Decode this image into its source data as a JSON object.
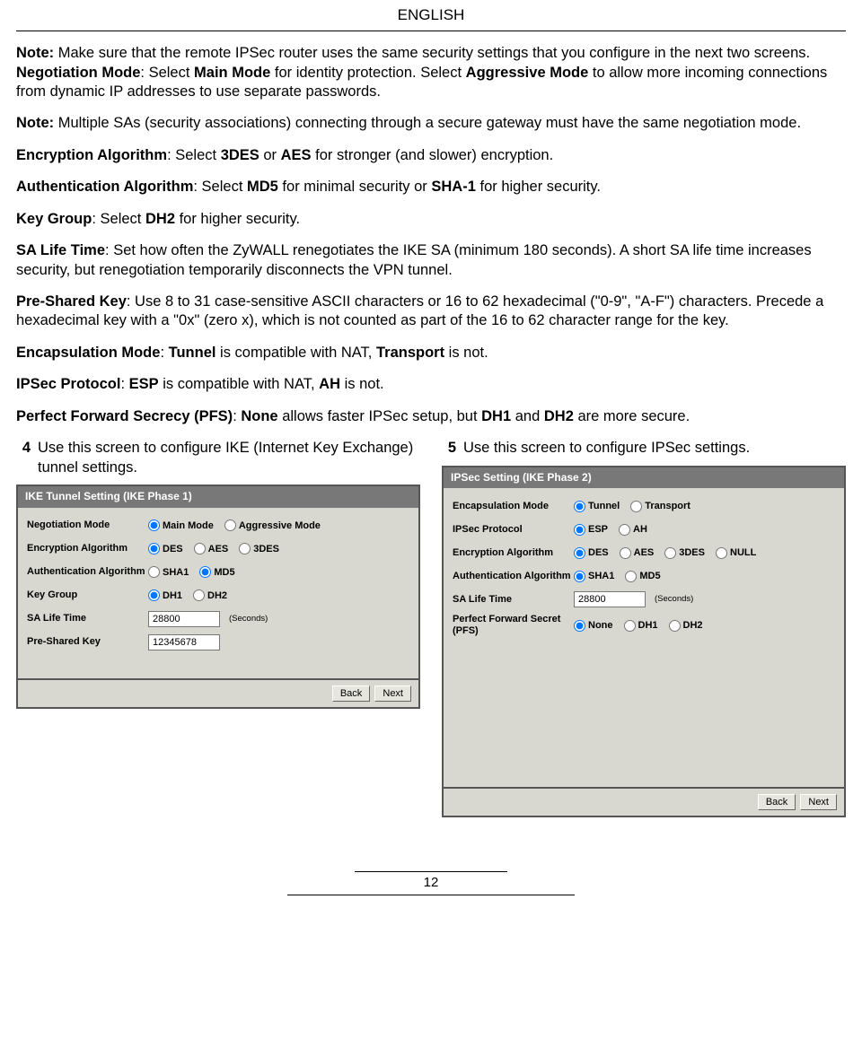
{
  "header": "ENGLISH",
  "paragraphs": {
    "p1a": "Note:",
    "p1b": " Make sure that the remote IPSec router uses the same security settings that you configure in the next two screens.",
    "p2a": "Negotiation Mode",
    "p2b": ": Select ",
    "p2c": "Main Mode",
    "p2d": " for identity protection. Select ",
    "p2e": "Aggressive Mode",
    "p2f": " to allow more incoming connections from dynamic IP addresses to use separate passwords.",
    "p3a": "Note:",
    "p3b": " Multiple SAs (security associations) connecting through a secure gateway must have the same negotiation mode.",
    "p4a": "Encryption Algorithm",
    "p4b": ": Select ",
    "p4c": "3DES",
    "p4d": " or ",
    "p4e": "AES",
    "p4f": " for stronger (and slower) encryption.",
    "p5a": "Authentication Algorithm",
    "p5b": ": Select ",
    "p5c": "MD5",
    "p5d": " for minimal security or ",
    "p5e": "SHA-1",
    "p5f": " for higher security.",
    "p6a": "Key Group",
    "p6b": ": Select ",
    "p6c": "DH2",
    "p6d": " for higher security.",
    "p7a": "SA Life Time",
    "p7b": ": Set how often the ZyWALL renegotiates the IKE SA (minimum 180 seconds). A short SA life time increases security, but renegotiation temporarily disconnects the VPN tunnel.",
    "p8a": "Pre-Shared Key",
    "p8b": ": Use 8 to 31 case-sensitive ASCII characters or 16 to 62 hexadecimal (\"0-9\", \"A-F\") characters. Precede a hexadecimal key with a \"0x\" (zero x), which is not counted as part of the 16 to 62 character range for the key.",
    "p9a": "Encapsulation Mode",
    "p9b": ": ",
    "p9c": "Tunnel",
    "p9d": " is compatible with NAT, ",
    "p9e": "Transport",
    "p9f": " is not.",
    "p10a": "IPSec Protocol",
    "p10b": ": ",
    "p10c": "ESP",
    "p10d": " is compatible with NAT,  ",
    "p10e": "AH",
    "p10f": " is not.",
    "p11a": "Perfect Forward Secrecy (PFS)",
    "p11b": ": ",
    "p11c": "None",
    "p11d": " allows faster IPSec setup, but ",
    "p11e": "DH1",
    "p11f": " and ",
    "p11g": "DH2",
    "p11h": " are more secure."
  },
  "step4": {
    "num": "4",
    "text": "Use this screen to configure IKE (Internet Key Exchange) tunnel settings."
  },
  "step5": {
    "num": "5",
    "text": "Use this screen to configure IPSec settings."
  },
  "panel1": {
    "title": "IKE Tunnel Setting (IKE Phase 1)",
    "negMode": {
      "label": "Negotiation Mode",
      "opts": [
        "Main Mode",
        "Aggressive Mode"
      ],
      "sel": 0
    },
    "encAlg": {
      "label": "Encryption Algorithm",
      "opts": [
        "DES",
        "AES",
        "3DES"
      ],
      "sel": 0
    },
    "authAlg": {
      "label": "Authentication Algorithm",
      "opts": [
        "SHA1",
        "MD5"
      ],
      "sel": 1
    },
    "keyGroup": {
      "label": "Key Group",
      "opts": [
        "DH1",
        "DH2"
      ],
      "sel": 0
    },
    "saLife": {
      "label": "SA Life Time",
      "value": "28800",
      "unit": "(Seconds)"
    },
    "psk": {
      "label": "Pre-Shared Key",
      "value": "12345678"
    },
    "back": "Back",
    "next": "Next"
  },
  "panel2": {
    "title": "IPSec Setting (IKE Phase 2)",
    "encapMode": {
      "label": "Encapsulation Mode",
      "opts": [
        "Tunnel",
        "Transport"
      ],
      "sel": 0
    },
    "ipsecProto": {
      "label": "IPSec Protocol",
      "opts": [
        "ESP",
        "AH"
      ],
      "sel": 0
    },
    "encAlg": {
      "label": "Encryption Algorithm",
      "opts": [
        "DES",
        "AES",
        "3DES",
        "NULL"
      ],
      "sel": 0
    },
    "authAlg": {
      "label": "Authentication Algorithm",
      "opts": [
        "SHA1",
        "MD5"
      ],
      "sel": 0
    },
    "saLife": {
      "label": "SA Life Time",
      "value": "28800",
      "unit": "(Seconds)"
    },
    "pfs": {
      "label": "Perfect Forward Secret (PFS)",
      "opts": [
        "None",
        "DH1",
        "DH2"
      ],
      "sel": 0
    },
    "back": "Back",
    "next": "Next"
  },
  "pageNum": "12"
}
